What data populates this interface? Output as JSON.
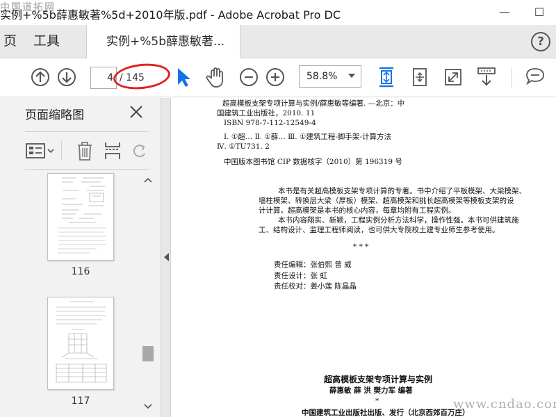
{
  "window": {
    "title": "实例+%5b薛惠敏著%5d+2010年版.pdf - Adobe Acrobat Pro DC",
    "min_glyph": "—",
    "max_glyph": "☐",
    "watermark_top_left": "中国道拓网"
  },
  "tabs": {
    "home": "页",
    "tools": "工具",
    "document": "实例+%5b薛惠敏著...",
    "close_glyph": "×",
    "help_glyph": "?"
  },
  "toolbar": {
    "page_current": "4",
    "page_total": "/ 145",
    "zoom": "58.8%",
    "icons": [
      "arrow-up-circle-icon",
      "arrow-down-circle-icon",
      "select-arrow-icon",
      "hand-icon",
      "zoom-out-icon",
      "zoom-in-icon",
      "fit-page-icon",
      "rotate-page-icon",
      "fullscreen-icon",
      "scroll-mode-icon",
      "comment-icon"
    ],
    "accent": "#1473e6",
    "annotation_color": "#e02020"
  },
  "sidebar": {
    "title": "页面缩略图",
    "thumbnails": [
      {
        "label": "116"
      },
      {
        "label": "117"
      }
    ]
  },
  "document": {
    "lines": [
      "超高模板支架专项计算与实例/薛惠敏等编著. —北京：中",
      "国建筑工业出版社，2010. 11",
      "ISBN 978-7-112-12549-4",
      "Ⅰ. ①超…   Ⅱ. ①薛…   Ⅲ. ①建筑工程-脚手架-计算方法",
      "Ⅳ. ①TU731. 2",
      "中国版本图书馆 CIP 数据核字（2010）第 196319 号",
      "本书是有关超高模板支架专项计算的专著。书中介绍了平板模架、大梁模架、",
      "墙柱模架、转换层大梁（厚板）模架、超高模架和挑长超高模架等模板支架的设",
      "计计算。超高模架是本书的核心内容，每章均附有工程实例。",
      "本书内容翔实、新颖，工程实例分析方法科学，操作性强。本书可供建筑施",
      "工、结构设计、监理工程师阅读，也可供大专院校土建专业师生参考使用。",
      "*          *          *",
      "责任编辑：张伯熙   曾   威",
      "责任设计：张   虹",
      "责任校对：姜小莲   陈晶晶",
      "超高模板支架专项计算与实例",
      "薛惠敏   薛   洪   樊力军   编著",
      "*",
      "中国建筑工业出版社出版、发行（北京西郊百万庄）"
    ]
  },
  "watermark_bottom_right": "www.cndao.com"
}
